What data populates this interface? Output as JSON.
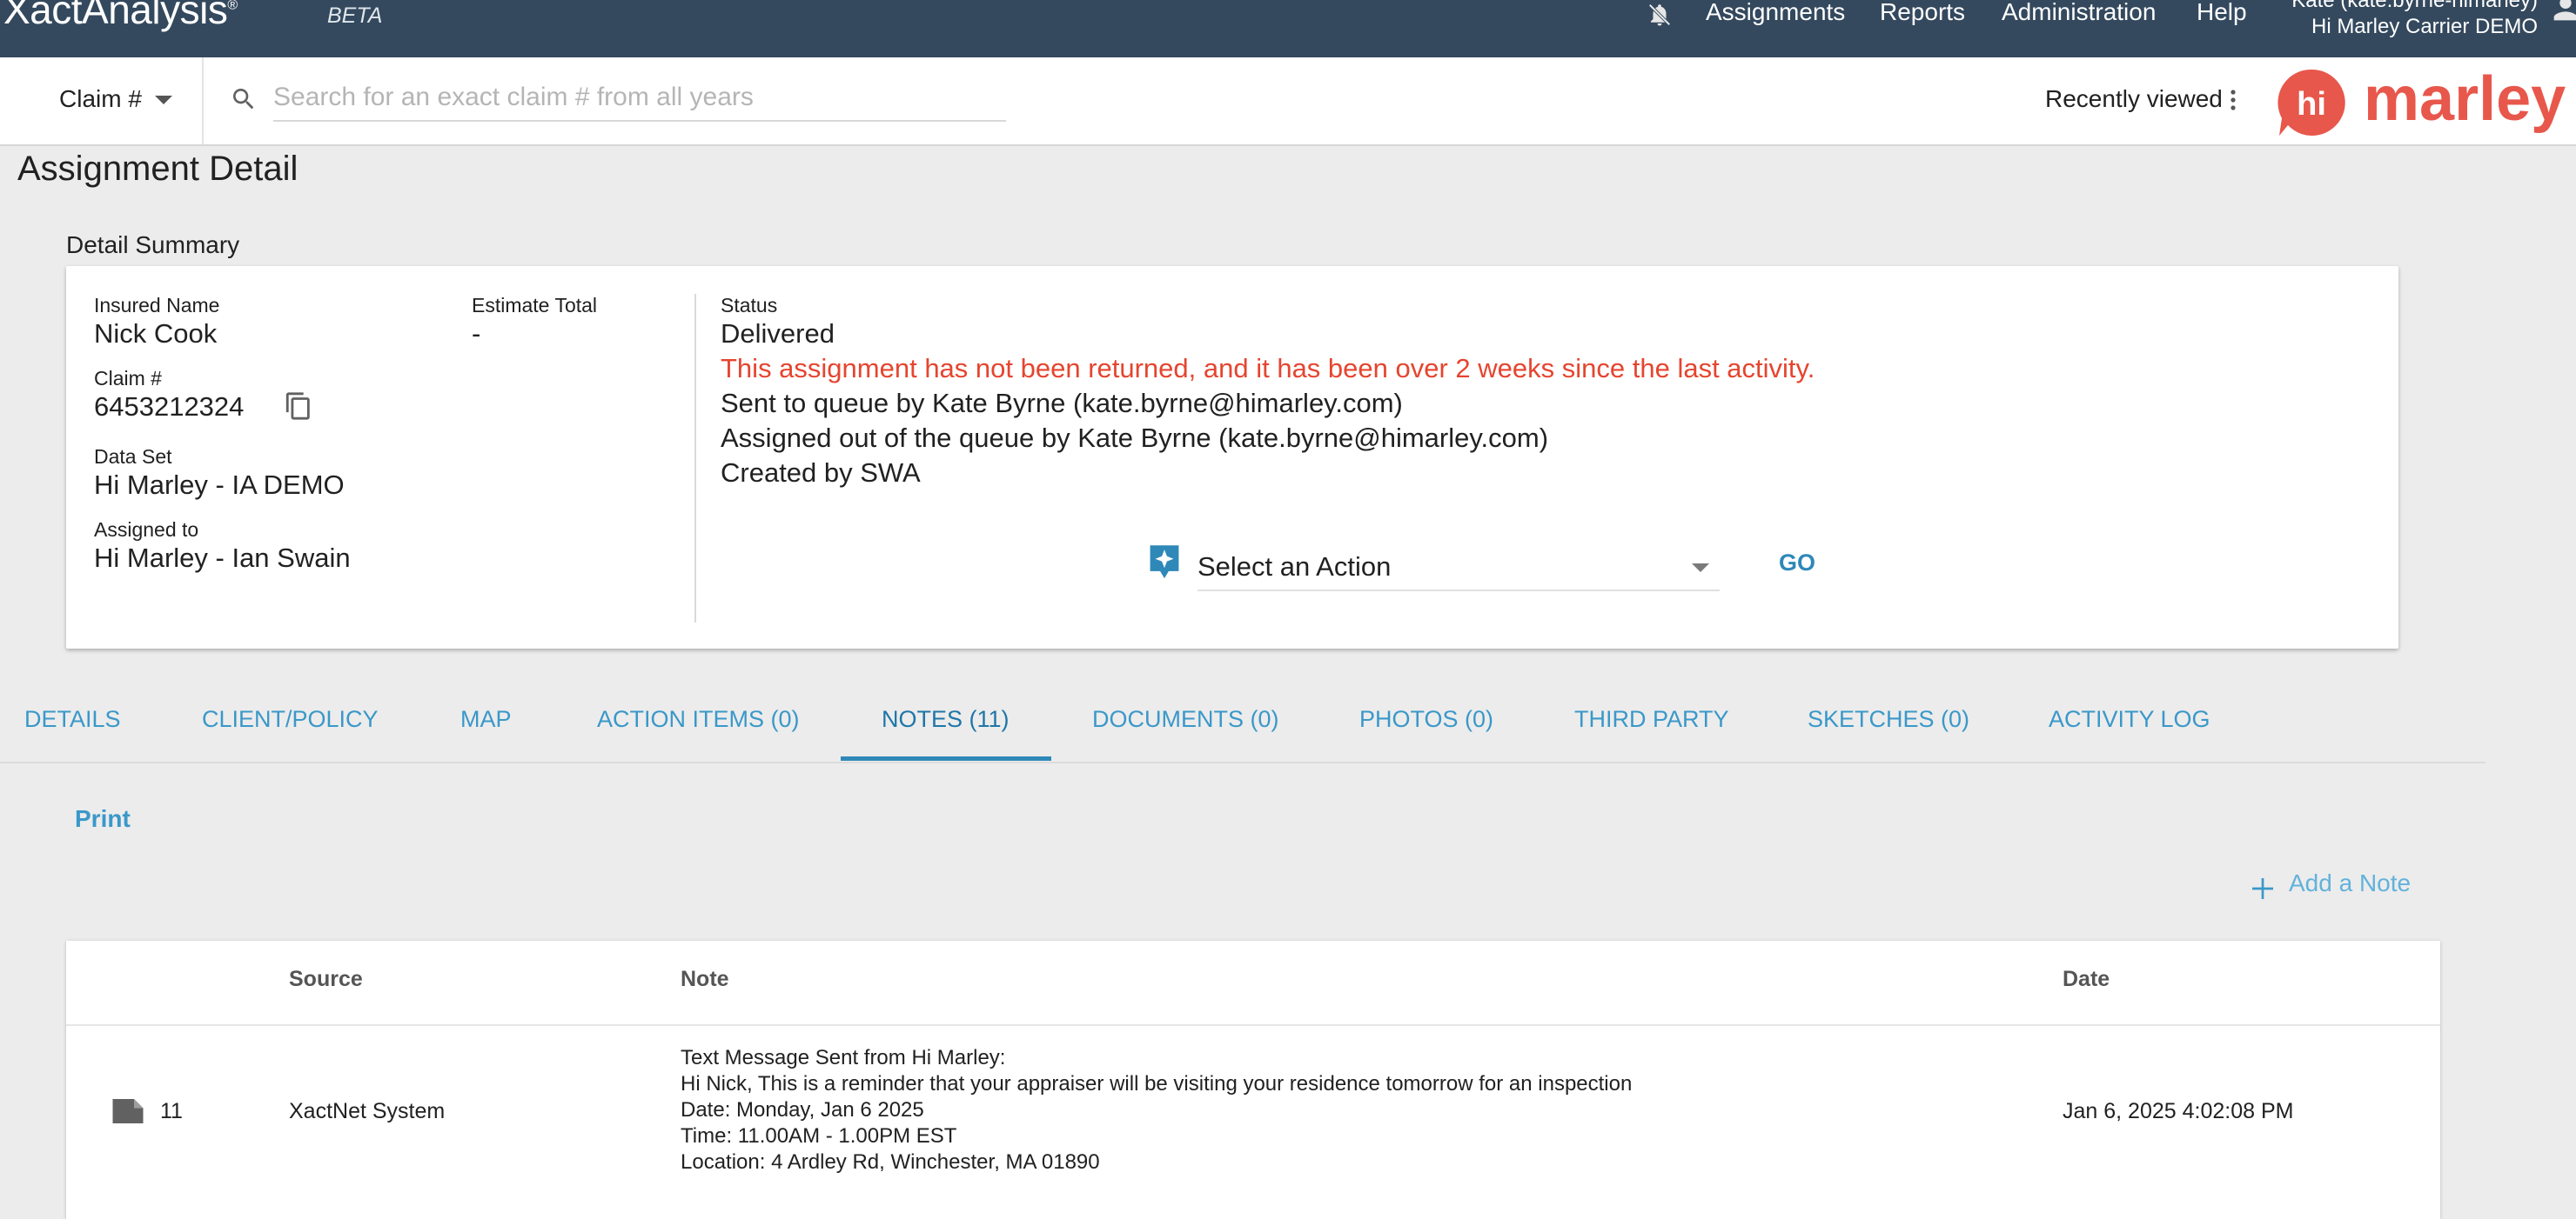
{
  "topbar": {
    "logo": "XactAnalysis",
    "logo_mark": "®",
    "beta": "BETA",
    "nav": [
      "Assignments",
      "Reports",
      "Administration",
      "Help"
    ],
    "user_line1": "Kate (kate.byrne-himarley)",
    "user_line2": "Hi Marley Carrier DEMO"
  },
  "searchbar": {
    "claim_select": "Claim #",
    "placeholder": "Search for an exact claim # from all years",
    "recently_viewed": "Recently viewed",
    "brand_hi": "hi",
    "brand_name": "marley"
  },
  "page": {
    "title": "Assignment Detail",
    "section": "Detail Summary"
  },
  "summary": {
    "insured_name_label": "Insured Name",
    "insured_name": "Nick Cook",
    "estimate_total_label": "Estimate Total",
    "estimate_total": "-",
    "claim_label": "Claim #",
    "claim_number": "6453212324",
    "data_set_label": "Data Set",
    "data_set": "Hi Marley - IA DEMO",
    "assigned_to_label": "Assigned to",
    "assigned_to": "Hi Marley - Ian Swain",
    "status_label": "Status",
    "status": "Delivered",
    "warning": "This assignment has not been returned, and it has been over 2 weeks since the last activity.",
    "history": [
      "Sent to queue by Kate Byrne (kate.byrne@himarley.com)",
      "Assigned out of the queue by Kate Byrne (kate.byrne@himarley.com)",
      "Created by SWA"
    ],
    "action_placeholder": "Select an Action",
    "go": "GO",
    "warn_color": "#e5452f"
  },
  "tabs": [
    {
      "label": "DETAILS"
    },
    {
      "label": "CLIENT/POLICY"
    },
    {
      "label": "MAP"
    },
    {
      "label": "ACTION ITEMS (0)"
    },
    {
      "label": "NOTES (11)",
      "active": true
    },
    {
      "label": "DOCUMENTS (0)"
    },
    {
      "label": "PHOTOS (0)"
    },
    {
      "label": "THIRD PARTY"
    },
    {
      "label": "SKETCHES (0)"
    },
    {
      "label": "ACTIVITY LOG"
    }
  ],
  "notes": {
    "print": "Print",
    "add_note": "Add a Note",
    "columns": {
      "source": "Source",
      "note": "Note",
      "date": "Date"
    },
    "rows": [
      {
        "number": "11",
        "source": "XactNet System",
        "note_lines": [
          "Text Message Sent from Hi Marley:",
          "Hi Nick, This is a reminder that your appraiser will be visiting your residence tomorrow for an inspection",
          "Date: Monday, Jan 6 2025",
          "Time: 11.00AM - 1.00PM EST",
          "Location: 4 Ardley Rd, Winchester, MA 01890"
        ],
        "date": "Jan 6, 2025 4:02:08 PM"
      }
    ]
  },
  "colors": {
    "nav_bg": "#34495e",
    "accent": "#2e88b8",
    "brand": "#e8574b"
  }
}
